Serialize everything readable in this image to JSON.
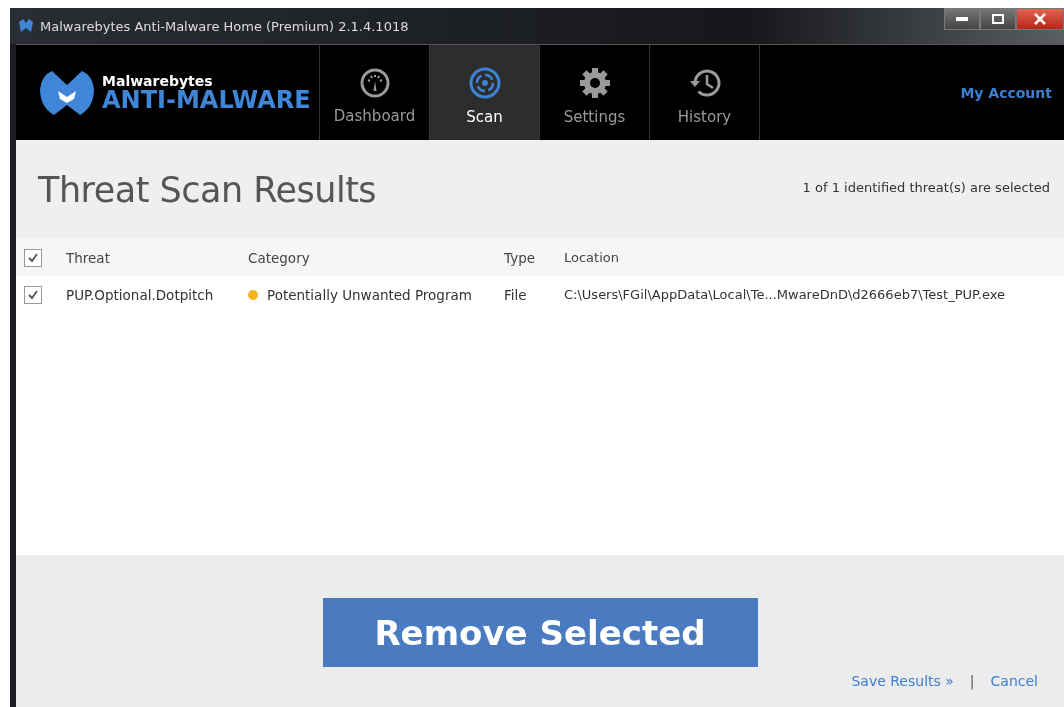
{
  "window": {
    "title": "Malwarebytes Anti-Malware Home (Premium) 2.1.4.1018"
  },
  "brand": {
    "name": "Malwarebytes",
    "product": "ANTI-MALWARE"
  },
  "nav": [
    {
      "label": "Dashboard",
      "selected": false
    },
    {
      "label": "Scan",
      "selected": true
    },
    {
      "label": "Settings",
      "selected": false
    },
    {
      "label": "History",
      "selected": false
    }
  ],
  "account_link": "My Account",
  "heading": "Threat Scan Results",
  "selection_note": "1 of 1 identified threat(s) are selected",
  "table": {
    "all_checked": true,
    "columns": [
      "Threat",
      "Category",
      "Type",
      "Location"
    ],
    "rows": [
      {
        "checked": true,
        "threat": "PUP.Optional.Dotpitch",
        "category": "Potentially Unwanted Program",
        "color": "#f7b31b",
        "type": "File",
        "location": "C:\\Users\\FGil\\AppData\\Local\\Te...MwareDnD\\d2666eb7\\Test_PUP.exe"
      }
    ]
  },
  "remove_button": "Remove Selected",
  "save_link": "Save Results »",
  "separator": "|",
  "cancel_link": "Cancel"
}
